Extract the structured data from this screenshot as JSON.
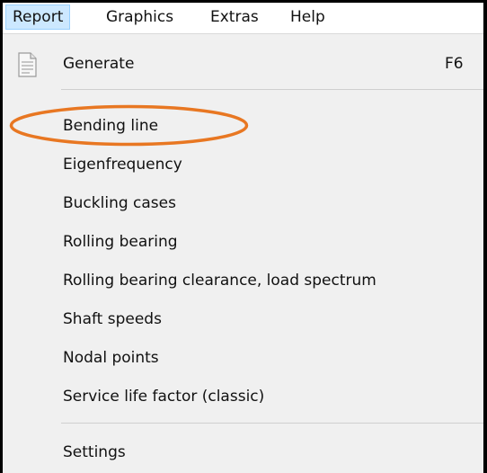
{
  "menubar": {
    "items": [
      {
        "label": "Report",
        "active": true
      },
      {
        "label": "Graphics"
      },
      {
        "label": "Extras"
      },
      {
        "label": "Help"
      }
    ]
  },
  "dropdown": {
    "generate": {
      "label": "Generate",
      "shortcut": "F6",
      "icon": "document-icon"
    },
    "items": [
      {
        "label": "Bending line",
        "highlighted": true
      },
      {
        "label": "Eigenfrequency"
      },
      {
        "label": "Buckling cases"
      },
      {
        "label": "Rolling bearing"
      },
      {
        "label": "Rolling bearing clearance, load spectrum"
      },
      {
        "label": "Shaft speeds"
      },
      {
        "label": "Nodal points"
      },
      {
        "label": "Service life factor (classic)"
      }
    ],
    "settings": {
      "label": "Settings"
    }
  },
  "colors": {
    "menu_background": "#f0f0f0",
    "active_menu": "#cce8ff",
    "annotation_ellipse": "#e87722"
  }
}
